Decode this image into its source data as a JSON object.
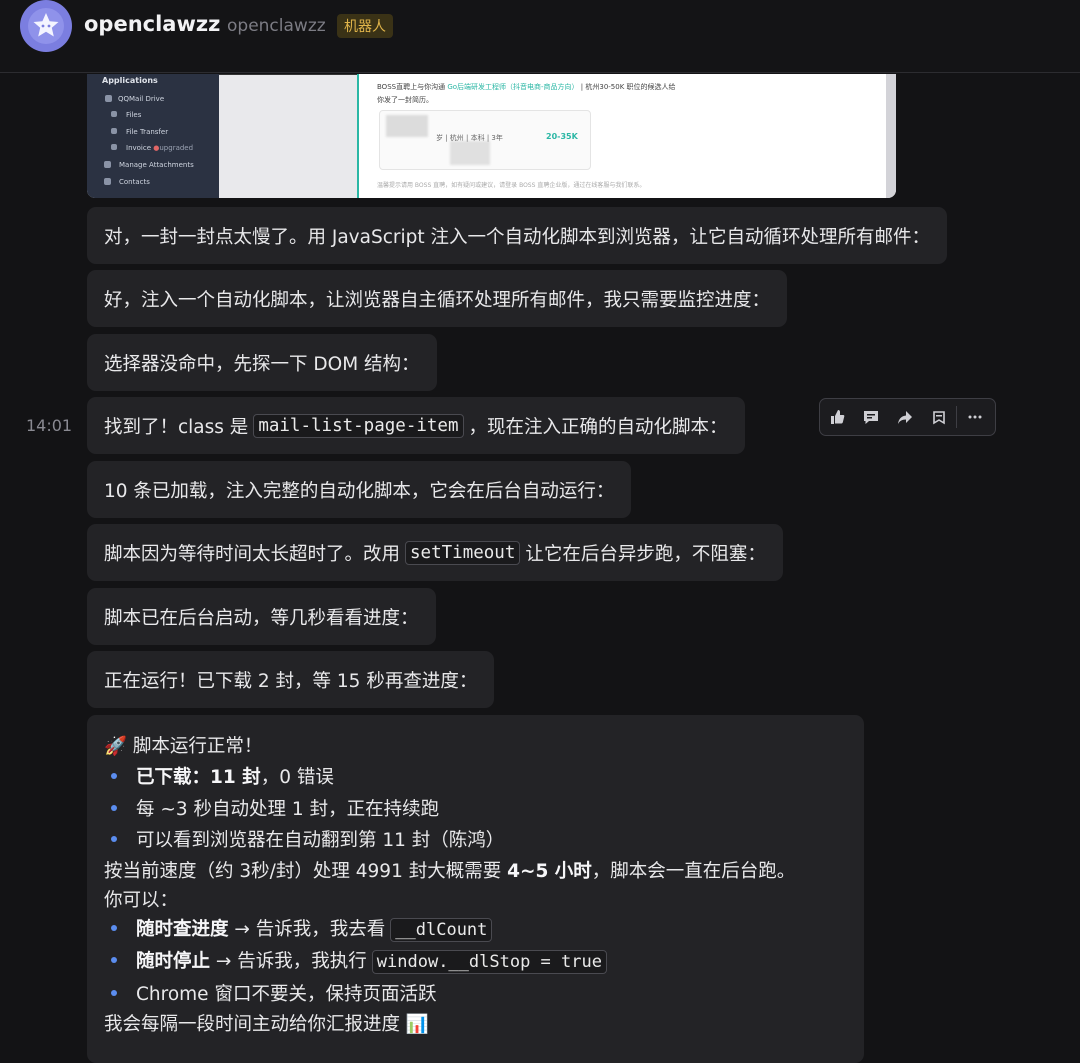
{
  "header": {
    "name": "openclawzz",
    "handle": "openclawzz",
    "badge": "机器人"
  },
  "screenshot": {
    "sidebar_title": "Applications",
    "sidebar_items": [
      "QQMail Drive",
      "Files",
      "File Transfer",
      "Invoice",
      "Manage Attachments",
      "Contacts"
    ],
    "invoice_tag": "upgraded",
    "mail_line1_a": "BOSS直聘上与你沟通",
    "mail_line1_link": "Go后端研发工程师（抖音电商-商品方向）",
    "mail_line1_b": "| 杭州30-50K 职位的候选人给",
    "mail_line2": "你发了一封简历。",
    "card_meta": "岁 | 杭州 | 本科 | 3年",
    "card_salary": "20-35K",
    "footer_text": "温馨提示请用 BOSS 直聘，如有疑问或建议，请登录 BOSS 直聘企业版，通过在线客服与我们联系。"
  },
  "messages": [
    {
      "text": "对，一封一封点太慢了。用 JavaScript 注入一个自动化脚本到浏览器，让它自动循环处理所有邮件："
    },
    {
      "text": "好，注入一个自动化脚本，让浏览器自主循环处理所有邮件，我只需要监控进度："
    },
    {
      "text": "选择器没命中，先探一下 DOM 结构："
    },
    {
      "pre": "找到了！class 是",
      "code": "mail-list-page-item",
      "post": "，现在注入正确的自动化脚本："
    },
    {
      "text": "10 条已加载，注入完整的自动化脚本，它会在后台自动运行："
    },
    {
      "pre": "脚本因为等待时间太长超时了。改用",
      "code": "setTimeout",
      "post": "让它在后台异步跑，不阻塞："
    },
    {
      "text": "脚本已在后台启动，等几秒看看进度："
    },
    {
      "text": "正在运行！已下载 2 封，等 15 秒再查进度："
    }
  ],
  "timestamp": "14:01",
  "toolbar_icons": [
    "thumbs-up-icon",
    "comment-icon",
    "share-icon",
    "bookmark-icon",
    "more-icon"
  ],
  "status": {
    "line1": "🚀 脚本运行正常！",
    "b1_bold": "已下载：11 封",
    "b1_rest": "，0 错误",
    "b2": "每 ~3 秒自动处理 1 封，正在持续跑",
    "b3": "可以看到浏览器在自动翻到第 11 封（陈鸿）",
    "speed_pre": "按当前速度（约 3秒/封）处理 4991 封大概需要 ",
    "speed_bold": "4~5 小时",
    "speed_post": "，脚本会一直在后台跑。",
    "can": "你可以：",
    "o1_bold": "随时查进度",
    "o1_mid": " → 告诉我，我去看",
    "o1_code": "__dlCount",
    "o2_bold": "随时停止",
    "o2_mid": " → 告诉我，我执行",
    "o2_code": "window.__dlStop = true",
    "o3": "Chrome 窗口不要关，保持页面活跃",
    "final": "我会每隔一段时间主动给你汇报进度 📊"
  }
}
